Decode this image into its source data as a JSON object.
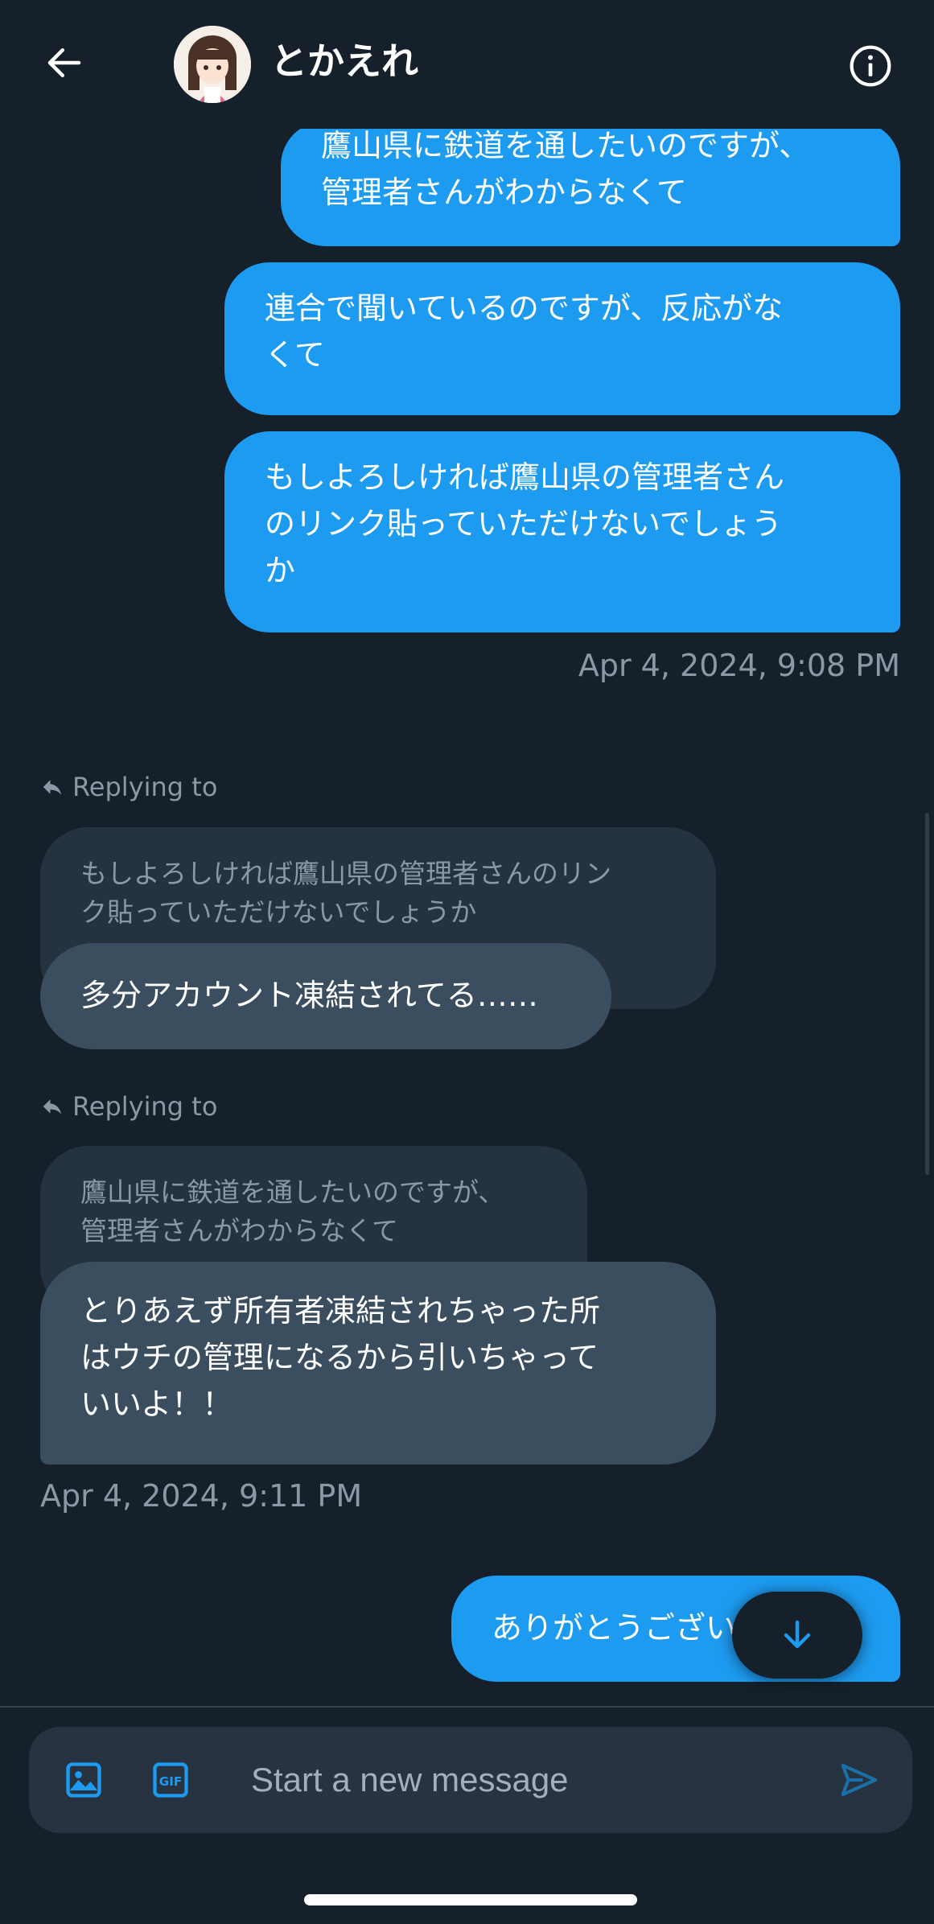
{
  "header": {
    "title": "とかえれ"
  },
  "messages": {
    "out1": {
      "line1": "鷹山県に鉄道を通したいのですが、",
      "line2": "管理者さんがわからなくて"
    },
    "out2": {
      "line1": "連合で聞いているのですが、反応がな",
      "line2": "くて"
    },
    "out3": {
      "line1": "もしよろしければ鷹山県の管理者さん",
      "line2": "のリンク貼っていただけないでしょう",
      "line3": "か"
    },
    "timestamp1": "Apr 4, 2024, 9:08 PM",
    "reply1": {
      "label": "Replying to",
      "quote_line1": "もしよろしければ鷹山県の管理者さんのリン",
      "quote_line2": "ク貼っていただけないでしょうか",
      "text": "多分アカウント凍結されてる……"
    },
    "reply2": {
      "label": "Replying to",
      "quote_line1": "鷹山県に鉄道を通したいのですが、",
      "quote_line2": "管理者さんがわからなくて",
      "line1": "とりあえず所有者凍結されちゃった所",
      "line2": "はウチの管理になるから引いちゃって",
      "line3": "いいよ！！"
    },
    "timestamp2": "Apr 4, 2024, 9:11 PM",
    "out4": {
      "text": "ありがとうござい"
    }
  },
  "composer": {
    "placeholder": "Start a new message",
    "gif_label": "GIF"
  },
  "colors": {
    "accent": "#1d9bf0",
    "background": "#15202b",
    "incoming": "#3a4e60",
    "quote": "#253341",
    "muted": "#8b98a5"
  }
}
